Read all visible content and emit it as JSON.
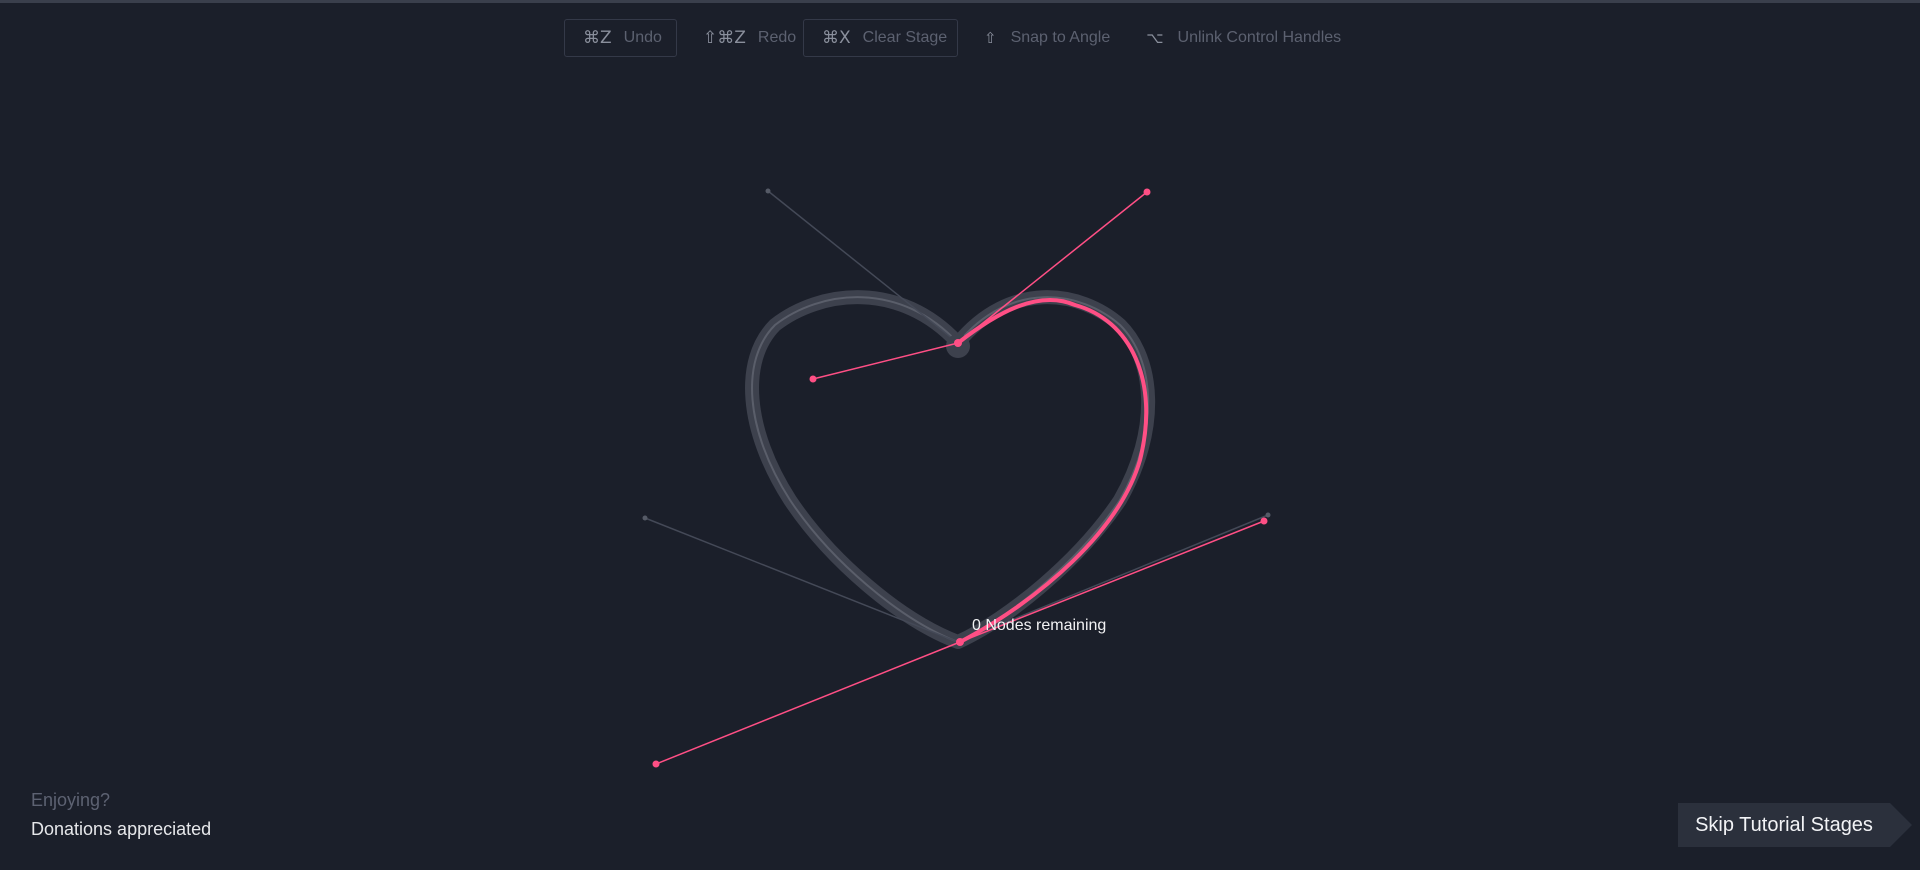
{
  "toolbar": {
    "undo": {
      "key": "⌘Z",
      "label": "Undo"
    },
    "redo": {
      "key": "⇧⌘Z",
      "label": "Redo"
    },
    "clear": {
      "key": "⌘X",
      "label": "Clear Stage"
    },
    "snap": {
      "key": "⇧",
      "label": "Snap to Angle"
    },
    "unlink": {
      "key": "⌥",
      "label": "Unlink Control Handles"
    }
  },
  "canvas": {
    "nodes_remaining": "0 Nodes remaining",
    "accent_color": "#ff4f85",
    "guide_color": "#4a4f5c"
  },
  "footer": {
    "enjoying": "Enjoying?",
    "donations": "Donations appreciated",
    "skip_label": "Skip Tutorial Stages"
  }
}
